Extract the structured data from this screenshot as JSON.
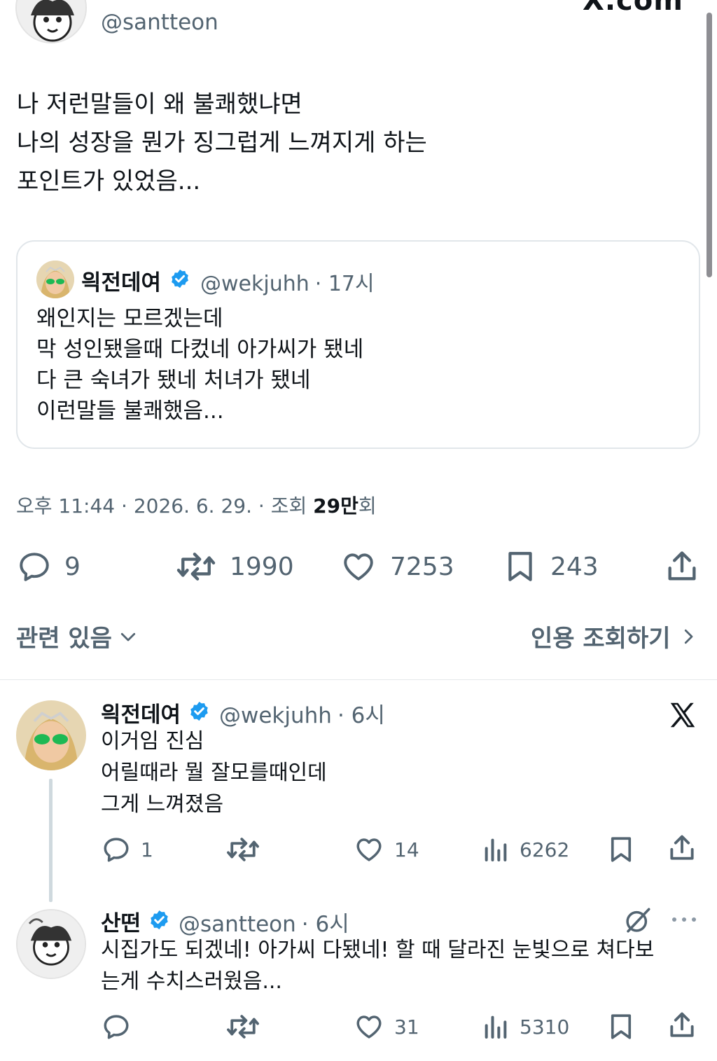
{
  "header": {
    "site_label": "X.com",
    "author_handle": "@santteon"
  },
  "post": {
    "lines": [
      "나 저런말들이 왜 불쾌했냐면",
      "나의 성장을 뭔가 징그럽게 느껴지게 하는",
      "포인트가 있었음..."
    ],
    "quote": {
      "name": "읙전데여",
      "handle": "@wekjuhh",
      "time": "· 17시",
      "lines": [
        "왜인지는 모르겠는데",
        "막 성인됐을때 다컸네 아가씨가 됐네",
        "다 큰 숙녀가 됐네 처녀가 됐네",
        "이런말들 불쾌했음..."
      ]
    },
    "timestamp_prefix": "오후 11:44 · 2026. 6. 29. · 조회 ",
    "views_bold": "29만",
    "views_suffix": "회",
    "stats": {
      "replies": "9",
      "reposts": "1990",
      "likes": "7253",
      "bookmarks": "243"
    },
    "related_label": "관련 있음",
    "quote_views_label": "인용 조회하기"
  },
  "replies": [
    {
      "name": "읙전데여",
      "handle": "@wekjuhh",
      "time": "· 6시",
      "lines": [
        "이거임 진심",
        "어릴때라 뭘 잘모를때인데",
        "그게 느껴졌음"
      ],
      "replies": "1",
      "likes": "14",
      "views": "6262"
    },
    {
      "name": "산떤",
      "handle": "@santteon",
      "time": "· 6시",
      "lines": [
        "시집가도 되겠네! 아가씨 다됐네! 할 때 달라진 눈빛으로 쳐다보",
        "는게 수치스러웠음..."
      ],
      "replies": "",
      "likes": "31",
      "views": "5310"
    }
  ],
  "colors": {
    "text": "#0f1419",
    "secondary": "#536471",
    "verified": "#1d9bf0",
    "border": "#e1e6ea"
  }
}
